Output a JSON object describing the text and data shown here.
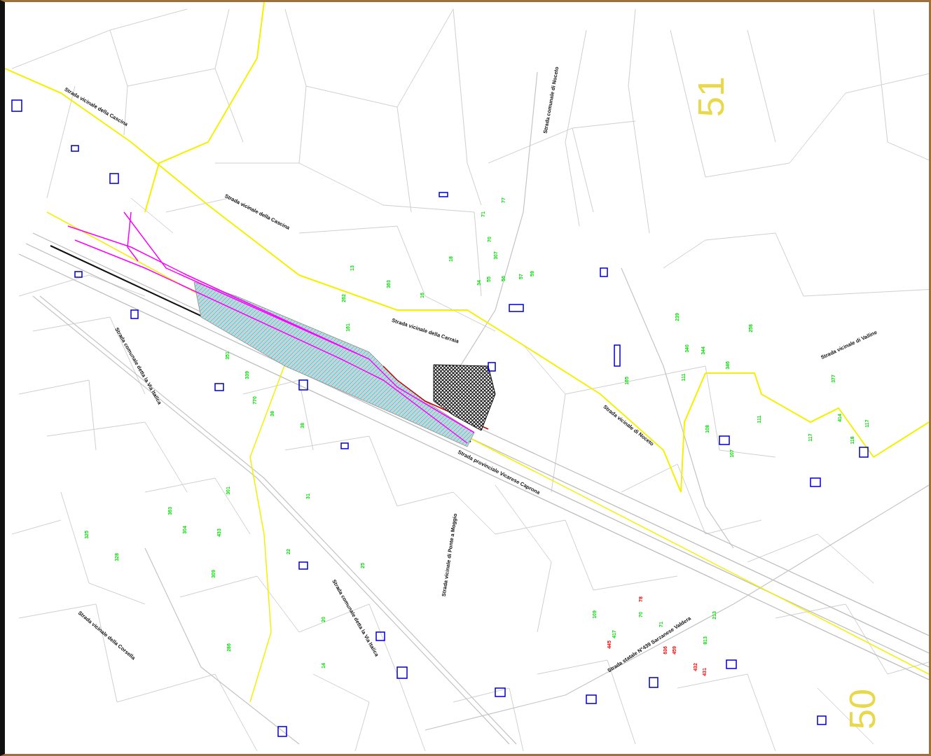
{
  "sheet_numbers": [
    "51",
    "50"
  ],
  "road_labels": [
    "Strada statale N°439 Sarzanese Valdera",
    "Strada provinciale Vicarese Caprona",
    "Strada comunale detta la Via Italica",
    "Strada comunale detta la Via Italica",
    "Strada vicinale della Corsella",
    "Strada vicinale della Cascina",
    "Strada vicinale della Cascina",
    "Strada vicinale della Carraia",
    "Strada vicinale di Valline",
    "Strada comunale di Noceto",
    "Strada vicinale di Noceto",
    "Strada vicinale di Ponte a Moggio"
  ],
  "parcel_numbers": [
    {
      "text": "13",
      "kind": "parcel"
    },
    {
      "text": "363",
      "kind": "parcel"
    },
    {
      "text": "18",
      "kind": "parcel"
    },
    {
      "text": "16",
      "kind": "parcel"
    },
    {
      "text": "262",
      "kind": "parcel"
    },
    {
      "text": "161",
      "kind": "parcel"
    },
    {
      "text": "71",
      "kind": "parcel"
    },
    {
      "text": "77",
      "kind": "parcel"
    },
    {
      "text": "70",
      "kind": "parcel"
    },
    {
      "text": "307",
      "kind": "parcel"
    },
    {
      "text": "34",
      "kind": "parcel"
    },
    {
      "text": "55",
      "kind": "parcel"
    },
    {
      "text": "56",
      "kind": "parcel"
    },
    {
      "text": "57",
      "kind": "parcel"
    },
    {
      "text": "59",
      "kind": "parcel"
    },
    {
      "text": "377",
      "kind": "parcel"
    },
    {
      "text": "111",
      "kind": "parcel"
    },
    {
      "text": "117",
      "kind": "parcel"
    },
    {
      "text": "117",
      "kind": "parcel"
    },
    {
      "text": "414",
      "kind": "parcel"
    },
    {
      "text": "118",
      "kind": "parcel"
    },
    {
      "text": "239",
      "kind": "parcel"
    },
    {
      "text": "258",
      "kind": "parcel"
    },
    {
      "text": "340",
      "kind": "parcel"
    },
    {
      "text": "344",
      "kind": "parcel"
    },
    {
      "text": "346",
      "kind": "parcel"
    },
    {
      "text": "111",
      "kind": "parcel"
    },
    {
      "text": "165",
      "kind": "parcel"
    },
    {
      "text": "108",
      "kind": "parcel"
    },
    {
      "text": "107",
      "kind": "parcel"
    },
    {
      "text": "813",
      "kind": "parcel"
    },
    {
      "text": "213",
      "kind": "parcel"
    },
    {
      "text": "70",
      "kind": "parcel"
    },
    {
      "text": "109",
      "kind": "parcel"
    },
    {
      "text": "417",
      "kind": "parcel"
    },
    {
      "text": "71",
      "kind": "parcel"
    },
    {
      "text": "351",
      "kind": "parcel"
    },
    {
      "text": "339",
      "kind": "parcel"
    },
    {
      "text": "770",
      "kind": "parcel"
    },
    {
      "text": "38",
      "kind": "parcel"
    },
    {
      "text": "38",
      "kind": "parcel"
    },
    {
      "text": "31",
      "kind": "parcel"
    },
    {
      "text": "301",
      "kind": "parcel"
    },
    {
      "text": "363",
      "kind": "parcel"
    },
    {
      "text": "304",
      "kind": "parcel"
    },
    {
      "text": "433",
      "kind": "parcel"
    },
    {
      "text": "309",
      "kind": "parcel"
    },
    {
      "text": "328",
      "kind": "parcel"
    },
    {
      "text": "325",
      "kind": "parcel"
    },
    {
      "text": "25",
      "kind": "parcel"
    },
    {
      "text": "14",
      "kind": "parcel"
    },
    {
      "text": "286",
      "kind": "parcel"
    },
    {
      "text": "20",
      "kind": "parcel"
    },
    {
      "text": "22",
      "kind": "parcel"
    },
    {
      "text": "78",
      "kind": "building"
    },
    {
      "text": "636",
      "kind": "building"
    },
    {
      "text": "459",
      "kind": "building"
    },
    {
      "text": "432",
      "kind": "building"
    },
    {
      "text": "431",
      "kind": "building"
    },
    {
      "text": "445",
      "kind": "building"
    }
  ]
}
